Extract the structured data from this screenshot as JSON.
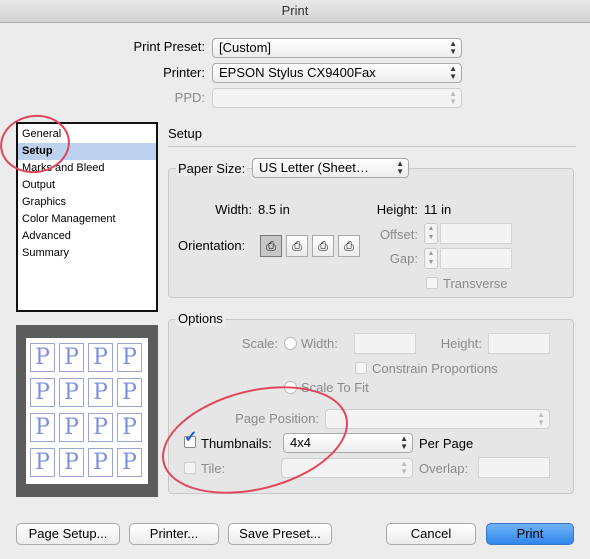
{
  "window": {
    "title": "Print"
  },
  "top": {
    "print_preset_label": "Print Preset:",
    "print_preset_value": "[Custom]",
    "printer_label": "Printer:",
    "printer_value": "EPSON Stylus CX9400Fax",
    "ppd_label": "PPD:",
    "ppd_value": ""
  },
  "sidebar": {
    "items": [
      {
        "label": "General",
        "selected": false
      },
      {
        "label": "Setup",
        "selected": true
      },
      {
        "label": "Marks and Bleed",
        "selected": false
      },
      {
        "label": "Output",
        "selected": false
      },
      {
        "label": "Graphics",
        "selected": false
      },
      {
        "label": "Color Management",
        "selected": false
      },
      {
        "label": "Advanced",
        "selected": false
      },
      {
        "label": "Summary",
        "selected": false
      }
    ]
  },
  "preview": {
    "glyph": "P",
    "grid": "4x4"
  },
  "setup": {
    "section_title": "Setup",
    "paper_size_label": "Paper Size:",
    "paper_size_value": "US Letter (Sheet…",
    "width_label": "Width:",
    "width_value": "8.5 in",
    "height_label": "Height:",
    "height_value": "11 in",
    "orientation_label": "Orientation:",
    "offset_label": "Offset:",
    "gap_label": "Gap:",
    "transverse_label": "Transverse"
  },
  "options": {
    "group_title": "Options",
    "scale_label": "Scale:",
    "width_label": "Width:",
    "height_label": "Height:",
    "constrain_label": "Constrain Proportions",
    "scale_to_fit_label": "Scale To Fit",
    "page_position_label": "Page Position:",
    "page_position_value": "",
    "thumbnails_label": "Thumbnails:",
    "thumbnails_checked": true,
    "thumbnails_value": "4x4",
    "per_page_label": "Per Page",
    "tile_label": "Tile:",
    "tile_value": "",
    "overlap_label": "Overlap:"
  },
  "buttons": {
    "page_setup": "Page Setup...",
    "printer": "Printer...",
    "save_preset": "Save Preset...",
    "cancel": "Cancel",
    "print": "Print"
  },
  "colors": {
    "annotation_circle": "#e0455c",
    "default_button": "#2f86ec",
    "selection": "#bcd2ee"
  }
}
